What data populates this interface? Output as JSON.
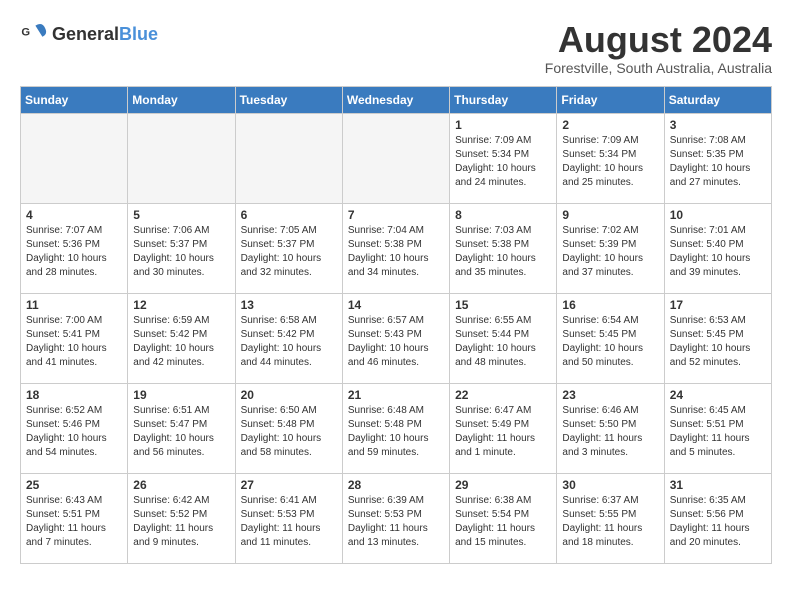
{
  "logo": {
    "general": "General",
    "blue": "Blue"
  },
  "title": {
    "month_year": "August 2024",
    "location": "Forestville, South Australia, Australia"
  },
  "headers": [
    "Sunday",
    "Monday",
    "Tuesday",
    "Wednesday",
    "Thursday",
    "Friday",
    "Saturday"
  ],
  "weeks": [
    [
      {
        "day": "",
        "sunrise": "",
        "sunset": "",
        "daylight": "",
        "empty": true
      },
      {
        "day": "",
        "sunrise": "",
        "sunset": "",
        "daylight": "",
        "empty": true
      },
      {
        "day": "",
        "sunrise": "",
        "sunset": "",
        "daylight": "",
        "empty": true
      },
      {
        "day": "",
        "sunrise": "",
        "sunset": "",
        "daylight": "",
        "empty": true
      },
      {
        "day": "1",
        "sunrise": "7:09 AM",
        "sunset": "5:34 PM",
        "daylight": "10 hours and 24 minutes."
      },
      {
        "day": "2",
        "sunrise": "7:09 AM",
        "sunset": "5:34 PM",
        "daylight": "10 hours and 25 minutes."
      },
      {
        "day": "3",
        "sunrise": "7:08 AM",
        "sunset": "5:35 PM",
        "daylight": "10 hours and 27 minutes."
      }
    ],
    [
      {
        "day": "4",
        "sunrise": "7:07 AM",
        "sunset": "5:36 PM",
        "daylight": "10 hours and 28 minutes."
      },
      {
        "day": "5",
        "sunrise": "7:06 AM",
        "sunset": "5:37 PM",
        "daylight": "10 hours and 30 minutes."
      },
      {
        "day": "6",
        "sunrise": "7:05 AM",
        "sunset": "5:37 PM",
        "daylight": "10 hours and 32 minutes."
      },
      {
        "day": "7",
        "sunrise": "7:04 AM",
        "sunset": "5:38 PM",
        "daylight": "10 hours and 34 minutes."
      },
      {
        "day": "8",
        "sunrise": "7:03 AM",
        "sunset": "5:38 PM",
        "daylight": "10 hours and 35 minutes."
      },
      {
        "day": "9",
        "sunrise": "7:02 AM",
        "sunset": "5:39 PM",
        "daylight": "10 hours and 37 minutes."
      },
      {
        "day": "10",
        "sunrise": "7:01 AM",
        "sunset": "5:40 PM",
        "daylight": "10 hours and 39 minutes."
      }
    ],
    [
      {
        "day": "11",
        "sunrise": "7:00 AM",
        "sunset": "5:41 PM",
        "daylight": "10 hours and 41 minutes."
      },
      {
        "day": "12",
        "sunrise": "6:59 AM",
        "sunset": "5:42 PM",
        "daylight": "10 hours and 42 minutes."
      },
      {
        "day": "13",
        "sunrise": "6:58 AM",
        "sunset": "5:42 PM",
        "daylight": "10 hours and 44 minutes."
      },
      {
        "day": "14",
        "sunrise": "6:57 AM",
        "sunset": "5:43 PM",
        "daylight": "10 hours and 46 minutes."
      },
      {
        "day": "15",
        "sunrise": "6:55 AM",
        "sunset": "5:44 PM",
        "daylight": "10 hours and 48 minutes."
      },
      {
        "day": "16",
        "sunrise": "6:54 AM",
        "sunset": "5:45 PM",
        "daylight": "10 hours and 50 minutes."
      },
      {
        "day": "17",
        "sunrise": "6:53 AM",
        "sunset": "5:45 PM",
        "daylight": "10 hours and 52 minutes."
      }
    ],
    [
      {
        "day": "18",
        "sunrise": "6:52 AM",
        "sunset": "5:46 PM",
        "daylight": "10 hours and 54 minutes."
      },
      {
        "day": "19",
        "sunrise": "6:51 AM",
        "sunset": "5:47 PM",
        "daylight": "10 hours and 56 minutes."
      },
      {
        "day": "20",
        "sunrise": "6:50 AM",
        "sunset": "5:48 PM",
        "daylight": "10 hours and 58 minutes."
      },
      {
        "day": "21",
        "sunrise": "6:48 AM",
        "sunset": "5:48 PM",
        "daylight": "10 hours and 59 minutes."
      },
      {
        "day": "22",
        "sunrise": "6:47 AM",
        "sunset": "5:49 PM",
        "daylight": "11 hours and 1 minute."
      },
      {
        "day": "23",
        "sunrise": "6:46 AM",
        "sunset": "5:50 PM",
        "daylight": "11 hours and 3 minutes."
      },
      {
        "day": "24",
        "sunrise": "6:45 AM",
        "sunset": "5:51 PM",
        "daylight": "11 hours and 5 minutes."
      }
    ],
    [
      {
        "day": "25",
        "sunrise": "6:43 AM",
        "sunset": "5:51 PM",
        "daylight": "11 hours and 7 minutes."
      },
      {
        "day": "26",
        "sunrise": "6:42 AM",
        "sunset": "5:52 PM",
        "daylight": "11 hours and 9 minutes."
      },
      {
        "day": "27",
        "sunrise": "6:41 AM",
        "sunset": "5:53 PM",
        "daylight": "11 hours and 11 minutes."
      },
      {
        "day": "28",
        "sunrise": "6:39 AM",
        "sunset": "5:53 PM",
        "daylight": "11 hours and 13 minutes."
      },
      {
        "day": "29",
        "sunrise": "6:38 AM",
        "sunset": "5:54 PM",
        "daylight": "11 hours and 15 minutes."
      },
      {
        "day": "30",
        "sunrise": "6:37 AM",
        "sunset": "5:55 PM",
        "daylight": "11 hours and 18 minutes."
      },
      {
        "day": "31",
        "sunrise": "6:35 AM",
        "sunset": "5:56 PM",
        "daylight": "11 hours and 20 minutes."
      }
    ]
  ]
}
